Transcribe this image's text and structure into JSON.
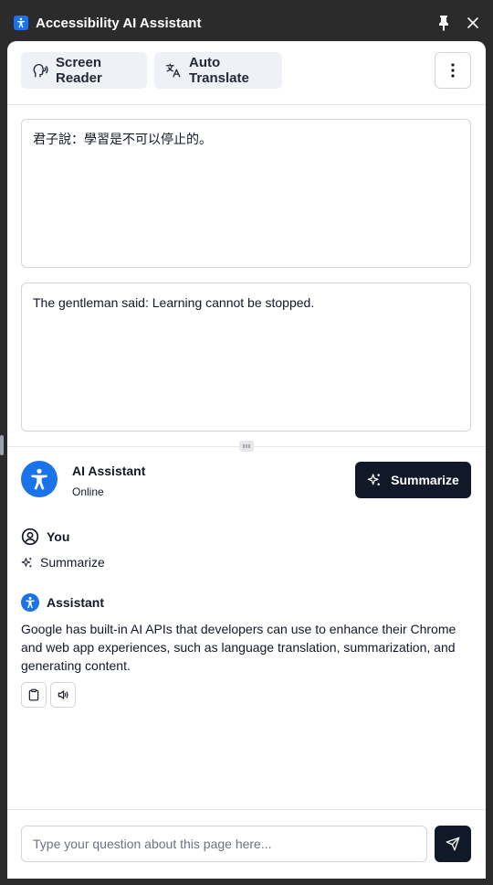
{
  "window": {
    "title": "Accessibility AI Assistant",
    "app_icon": "accessibility-icon",
    "pin_icon": "pin-icon",
    "close_icon": "close-icon"
  },
  "toolbar": {
    "screen_reader_label": "Screen Reader",
    "screen_reader_icon": "speaking-head-icon",
    "auto_translate_label": "Auto Translate",
    "auto_translate_icon": "translate-icon",
    "more_icon": "more-vertical-icon"
  },
  "source_text": "君子說：學習是不可以停止的。",
  "translated_text": "The gentleman said: Learning cannot be stopped.",
  "assistant_header": {
    "name": "AI Assistant",
    "status": "Online",
    "summarize_label": "Summarize",
    "summarize_icon": "sparkles-icon"
  },
  "chat": {
    "user": {
      "author": "You",
      "icon": "user-circle-icon",
      "message": "Summarize",
      "message_icon": "sparkles-icon"
    },
    "assistant": {
      "author": "Assistant",
      "icon": "accessibility-icon",
      "message": "Google has built-in AI APIs that developers can use to enhance their Chrome and web app experiences, such as language translation, summarization, and generating content.",
      "actions": [
        "copy-icon",
        "speaker-icon"
      ]
    }
  },
  "footer": {
    "placeholder": "Type your question about this page here...",
    "send_icon": "send-icon"
  },
  "colors": {
    "brand": "#1a73e8",
    "dark_button": "#111827",
    "chip_bg": "#eef1f6",
    "chrome": "#2b2b2b"
  }
}
